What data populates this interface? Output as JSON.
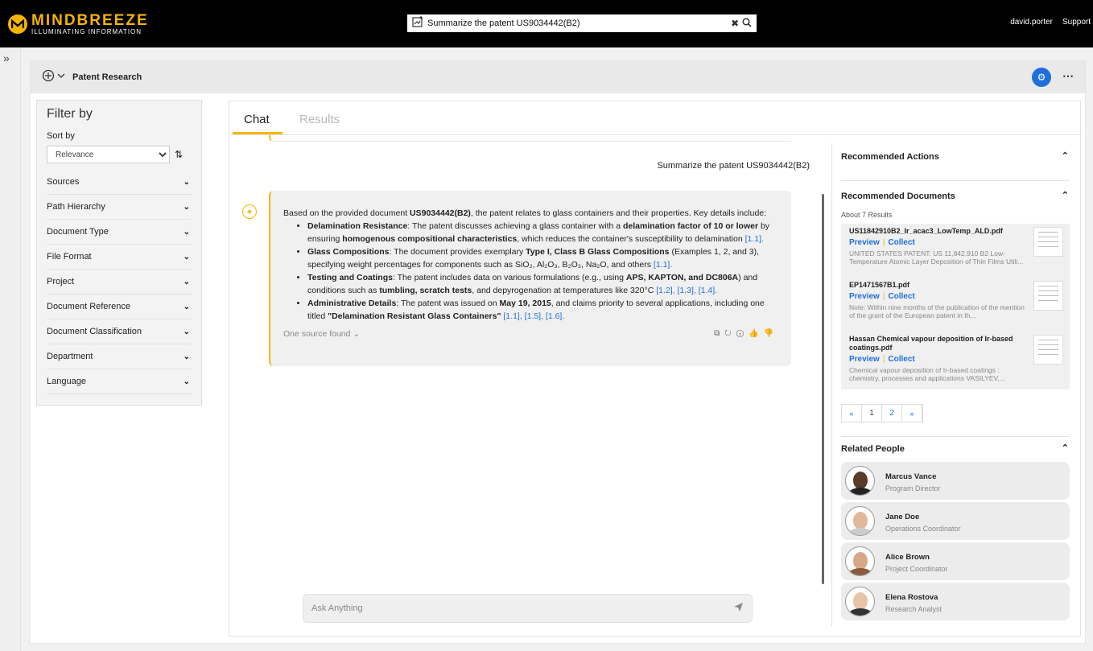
{
  "app": {
    "brand_name": "MINDBREEZE",
    "brand_tagline": "ILLUMINATING INFORMATION",
    "search_query": "Summarize the patent US9034442(B2)",
    "user": "david.porter",
    "support": "Support"
  },
  "header": {
    "title": "Patent Research"
  },
  "filter": {
    "heading": "Filter by",
    "sort_label": "Sort by",
    "sort_value": "Relevance",
    "facets": [
      "Sources",
      "Path Hierarchy",
      "Document Type",
      "File Format",
      "Project",
      "Document Reference",
      "Document Classification",
      "Department",
      "Language"
    ]
  },
  "tabs": {
    "chat": "Chat",
    "results": "Results"
  },
  "chat": {
    "user_question": "Summarize the patent US9034442(B2)",
    "answer": {
      "intro_prefix": "Based on the provided document ",
      "intro_doc": "US9034442(B2)",
      "intro_suffix": ", the patent relates to glass containers and their properties. Key details include:",
      "bullets": [
        {
          "title": "Delamination Resistance",
          "text": ": The patent discusses achieving a glass container with a ",
          "b1": "delamination factor of 10 or lower",
          "text2": " by ensuring ",
          "b2": "homogenous compositional characteristics",
          "text3": ", which reduces the container's susceptibility to delamination ",
          "refs": "[1.1]."
        },
        {
          "title": "Glass Compositions",
          "text": ": The document provides exemplary ",
          "b1": "Type I, Class B Glass Compositions",
          "text2": " (Examples 1, 2, and 3), specifying weight percentages for components such as SiO₂, Al₂O₃, B₂O₃, Na₂O, and others ",
          "b2": "",
          "text3": "",
          "refs": "[1.1]."
        },
        {
          "title": "Testing and Coatings",
          "text": ": The patent includes data on various formulations (e.g., using ",
          "b1": "APS, KAPTON, and DC806A",
          "text2": ") and conditions such as ",
          "b2": "tumbling, scratch tests",
          "text3": ", and depyrogenation at temperatures like 320°C ",
          "refs": "[1.2], [1.3], [1.4]."
        },
        {
          "title": "Administrative Details",
          "text": ": The patent was issued on ",
          "b1": "May 19, 2015",
          "text2": ", and claims priority to several applications, including one titled ",
          "b2": "\"Delamination Resistant Glass Containers\"",
          "text3": " ",
          "refs": "[1.1], [1.5], [1.6]."
        }
      ],
      "source_toggle": "One source found"
    },
    "input_placeholder": "Ask Anything"
  },
  "right": {
    "recommended_actions": "Recommended Actions",
    "recommended_documents": "Recommended Documents",
    "results_count": "About 7 Results",
    "preview_label": "Preview",
    "collect_label": "Collect",
    "docs": [
      {
        "title": "US11842910B2_Ir_acac3_LowTemp_ALD.pdf",
        "snippet": "UNITED STATES PATENT: US 11,842,910 B2 Low-Temperature Atomic Layer Deposition of Thin Films Utili..."
      },
      {
        "title": "EP1471567B1.pdf",
        "snippet": "Note: Within nine months of the publication of the mention of the grant of the European patent in th..."
      },
      {
        "title": "Hassan Chemical vapour deposition of Ir-based coatings.pdf",
        "snippet": "Chemical vapour deposition of Ir-based coatings : chemistry, processes and applications VASILYEV,..."
      }
    ],
    "pager": [
      "«",
      "1",
      "2",
      "»"
    ],
    "related_people": "Related People",
    "people": [
      {
        "name": "Marcus Vance",
        "role": "Program Director"
      },
      {
        "name": "Jane Doe",
        "role": "Operations Coordinator"
      },
      {
        "name": "Alice Brown",
        "role": "Project Coordinator"
      },
      {
        "name": "Elena Rostova",
        "role": "Research Analyst"
      }
    ]
  },
  "colors": {
    "accent": "#f5b400",
    "link": "#1e6fd9",
    "topbar": "#000000"
  }
}
